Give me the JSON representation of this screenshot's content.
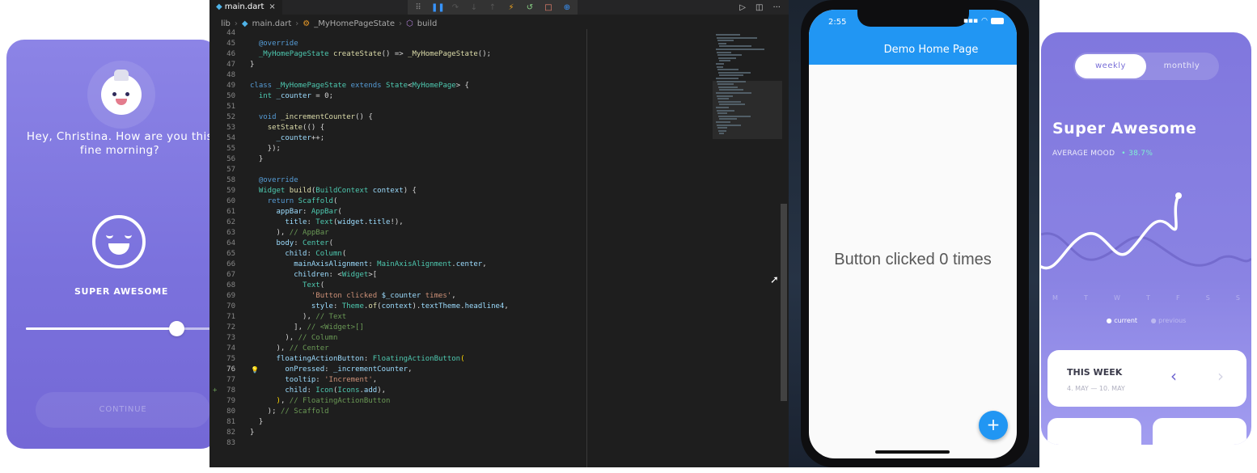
{
  "mood_card": {
    "greeting": "Hey, Christina. How are you this fine morning?",
    "mood_label": "SUPER AWESOME",
    "slider_value": 0.8,
    "continue_label": "CONTINUE"
  },
  "editor": {
    "tab_label": "main.dart",
    "tab_close": "×",
    "breadcrumb": [
      "lib",
      "main.dart",
      "_MyHomePageState",
      "build"
    ],
    "debug_icons": [
      "⠿",
      "❚❚",
      "↷",
      "↓",
      "↑",
      "⚡",
      "↺",
      "□",
      "⊕"
    ],
    "actions": [
      "▷",
      "◫",
      "···"
    ],
    "lines": [
      {
        "n": "44",
        "html": ""
      },
      {
        "n": "45",
        "html": "  <span class='k'>@override</span>"
      },
      {
        "n": "46",
        "html": "  <span class='t'>_MyHomePageState</span> <span class='f'>createState</span>() => <span class='f'>_MyHomePageState</span>();"
      },
      {
        "n": "47",
        "html": "}"
      },
      {
        "n": "48",
        "html": ""
      },
      {
        "n": "49",
        "html": "<span class='k'>class</span> <span class='t'>_MyHomePageState</span> <span class='k'>extends</span> <span class='t'>State</span>&lt;<span class='t'>MyHomePage</span>&gt; {"
      },
      {
        "n": "50",
        "html": "  <span class='t'>int</span> <span class='v'>_counter</span> = 0;"
      },
      {
        "n": "51",
        "html": ""
      },
      {
        "n": "52",
        "html": "  <span class='k'>void</span> <span class='f'>_incrementCounter</span>() {"
      },
      {
        "n": "53",
        "html": "    <span class='f'>setState</span>(() {"
      },
      {
        "n": "54",
        "html": "      <span class='v'>_counter</span>++;"
      },
      {
        "n": "55",
        "html": "    });"
      },
      {
        "n": "56",
        "html": "  }"
      },
      {
        "n": "57",
        "html": ""
      },
      {
        "n": "58",
        "html": "  <span class='k'>@override</span>"
      },
      {
        "n": "59",
        "html": "  <span class='t'>Widget</span> <span class='f'>build</span>(<span class='t'>BuildContext</span> <span class='v'>context</span>) {"
      },
      {
        "n": "60",
        "html": "    <span class='k'>return</span> <span class='t'>Scaffold</span>("
      },
      {
        "n": "61",
        "html": "      <span class='v'>appBar</span>: <span class='t'>AppBar</span>("
      },
      {
        "n": "62",
        "html": "        <span class='v'>title</span>: <span class='t'>Text</span>(<span class='v'>widget</span>.<span class='v'>title</span>!),"
      },
      {
        "n": "63",
        "html": "      ), <span class='c'>// AppBar</span>"
      },
      {
        "n": "64",
        "html": "      <span class='v'>body</span>: <span class='t'>Center</span>("
      },
      {
        "n": "65",
        "html": "        <span class='v'>child</span>: <span class='t'>Column</span>("
      },
      {
        "n": "66",
        "html": "          <span class='v'>mainAxisAlignment</span>: <span class='t'>MainAxisAlignment</span>.<span class='v'>center</span>,"
      },
      {
        "n": "67",
        "html": "          <span class='v'>children</span>: &lt;<span class='t'>Widget</span>&gt;["
      },
      {
        "n": "68",
        "html": "            <span class='t'>Text</span>("
      },
      {
        "n": "69",
        "html": "              <span class='s'>'Button clicked </span><span class='v'>$_counter</span><span class='s'> times'</span>,"
      },
      {
        "n": "70",
        "html": "              <span class='v'>style</span>: <span class='t'>Theme</span>.<span class='f'>of</span>(<span class='v'>context</span>).<span class='v'>textTheme</span>.<span class='v'>headline4</span>,"
      },
      {
        "n": "71",
        "html": "            ), <span class='c'>// Text</span>"
      },
      {
        "n": "72",
        "html": "          ], <span class='c'>// &lt;Widget&gt;[]</span>"
      },
      {
        "n": "73",
        "html": "        ), <span class='c'>// Column</span>"
      },
      {
        "n": "74",
        "html": "      ), <span class='c'>// Center</span>"
      },
      {
        "n": "75",
        "html": "      <span class='v'>floatingActionButton</span>: <span class='t'>FloatingActionButton</span><span class='p'>(</span>"
      },
      {
        "n": "76",
        "html": "        <span class='v'>onPressed</span>: <span class='v'>_incrementCounter</span>,"
      },
      {
        "n": "77",
        "html": "        <span class='v'>tooltip</span>: <span class='s'>'Increment'</span>,"
      },
      {
        "n": "78",
        "html": "        <span class='v'>child</span>: <span class='t'>Icon</span>(<span class='t'>Icons</span>.<span class='v'>add</span>),"
      },
      {
        "n": "79",
        "html": "      <span class='p'>)</span>, <span class='c'>// FloatingActionButton</span>"
      },
      {
        "n": "80",
        "html": "    ); <span class='c'>// Scaffold</span>"
      },
      {
        "n": "81",
        "html": "  }"
      },
      {
        "n": "82",
        "html": "}"
      },
      {
        "n": "83",
        "html": ""
      }
    ],
    "active_line": "76"
  },
  "phone": {
    "time": "2:55",
    "title": "Demo Home Page",
    "counter_text": "Button clicked 0 times",
    "fab_symbol": "+"
  },
  "stats_card": {
    "tab_weekly": "weekly",
    "tab_monthly": "monthly",
    "title": "Super Awesome",
    "average_label": "AVERAGE MOOD",
    "average_value": "38.7%",
    "days": [
      "M",
      "T",
      "W",
      "T",
      "F",
      "S",
      "S"
    ],
    "legend_current": "current",
    "legend_previous": "previous",
    "week_title": "THIS WEEK",
    "week_range": "4. MAY — 10. MAY"
  },
  "colors": {
    "appbar": "#2196f3",
    "card_purple": "#7b72dd",
    "editor_bg": "#1e1e1e"
  }
}
